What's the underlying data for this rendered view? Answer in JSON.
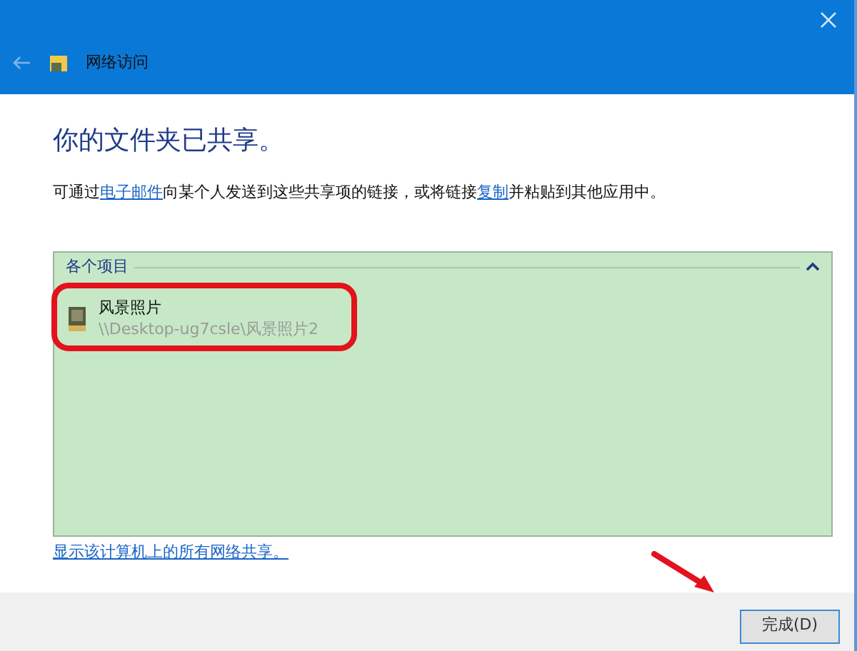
{
  "window": {
    "title": "网络访问"
  },
  "heading": "你的文件夹已共享。",
  "message": [
    {
      "kind": "text",
      "text": "可通过"
    },
    {
      "kind": "link",
      "text": "电子邮件"
    },
    {
      "kind": "text",
      "text": "向某个人发送到这些共享项的链接，或将链接"
    },
    {
      "kind": "link",
      "text": "复制"
    },
    {
      "kind": "text",
      "text": "并粘贴到其他应用中。"
    }
  ],
  "group": {
    "title": "各个项目",
    "expanded": true,
    "items": [
      {
        "name": "风景照片",
        "path": "\\\\Desktop-ug7csle\\风景照片2"
      }
    ]
  },
  "link": "显示该计算机上的所有网络共享。",
  "buttons": [
    "完成(D)"
  ]
}
